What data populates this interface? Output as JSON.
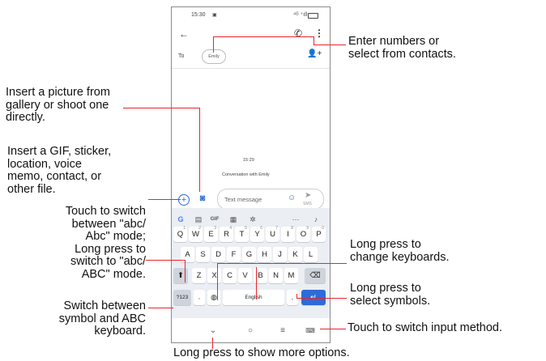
{
  "status": {
    "time": "15:30",
    "right": "⁴ᴳ ⁺ıll"
  },
  "header": {
    "to_label": "To",
    "recipient": "Emily"
  },
  "conversation": {
    "time": "15:29",
    "title": "Conversation with Emily"
  },
  "compose": {
    "placeholder": "Text message",
    "send_sub": "SMS"
  },
  "toolbar": {
    "gif": "GIF",
    "more": "···"
  },
  "keyboard": {
    "row1": [
      {
        "k": "Q",
        "n": "1"
      },
      {
        "k": "W",
        "n": "2"
      },
      {
        "k": "E",
        "n": "3"
      },
      {
        "k": "R",
        "n": "4"
      },
      {
        "k": "T",
        "n": "5"
      },
      {
        "k": "Y",
        "n": "6"
      },
      {
        "k": "U",
        "n": "7"
      },
      {
        "k": "I",
        "n": "8"
      },
      {
        "k": "O",
        "n": "9"
      },
      {
        "k": "P",
        "n": "0"
      }
    ],
    "row2": [
      "A",
      "S",
      "D",
      "F",
      "G",
      "H",
      "J",
      "K",
      "L"
    ],
    "row3": [
      "Z",
      "X",
      "C",
      "V",
      "B",
      "N",
      "M"
    ],
    "sym": "?123",
    "comma": ",",
    "space": "English",
    "period": "."
  },
  "callouts": {
    "numbers": "Enter numbers or\nselect from contacts.",
    "picture": "Insert a picture from\ngallery or shoot one\ndirectly.",
    "gif": "Insert a GIF, sticker,\nlocation, voice\nmemo, contact, or\nother file.",
    "switch_abc": "Touch to switch\nbetween \"abc/\nAbc\" mode;\nLong press to\nswitch to \"abc/\nABC\" mode.",
    "symbol_kbd": "Switch between\nsymbol and ABC\nkeyboard.",
    "change_kbd": "Long press to\nchange keyboards.",
    "symbols": "Long press to\nselect symbols.",
    "input_method": "Touch to switch input method.",
    "more_options": "Long press to show more options."
  }
}
